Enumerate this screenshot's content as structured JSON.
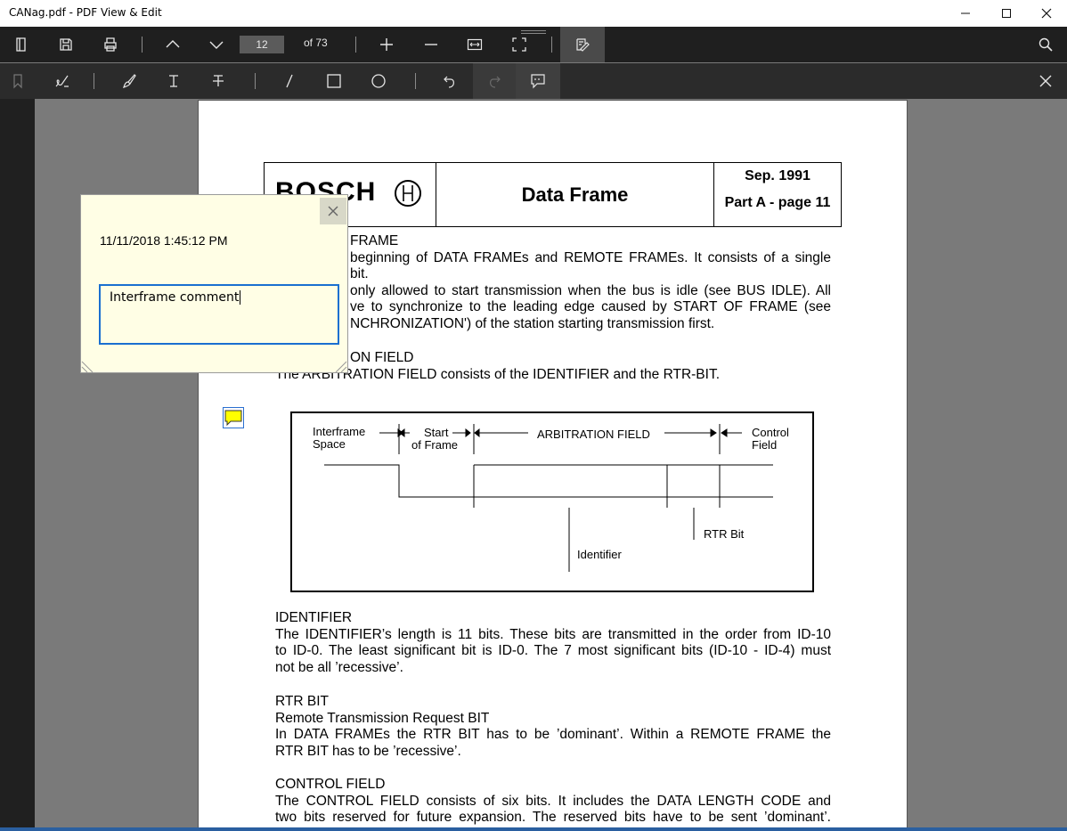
{
  "window": {
    "title": "CANag.pdf - PDF View & Edit"
  },
  "toolbar": {
    "page_number": "12",
    "page_total": "of 73"
  },
  "header": {
    "logo_text": "BOSCH",
    "title": "Data Frame",
    "date": "Sep. 1991",
    "part": "Part A - page 11"
  },
  "body": {
    "sof_heading": "FRAME",
    "sof_lines": [
      "beginning of DATA FRAMEs and REMOTE FRAMEs. It consists of a single",
      "bit.",
      "only allowed to start transmission when the bus is idle (see BUS IDLE). All",
      "ve to synchronize to the leading edge caused by START OF FRAME (see",
      "NCHRONIZATION') of the station starting transmission first."
    ],
    "arb_heading": "ON FIELD",
    "arb_line": "The ARBITRATION FIELD consists of the IDENTIFIER and the RTR-BIT.",
    "identifier_heading": "IDENTIFIER",
    "identifier_lines": [
      "The IDENTIFIER’s length is 11 bits. These bits are transmitted in the order from ID-10",
      "to ID-0. The least significant bit is ID-0. The 7 most significant bits (ID-10 - ID-4) must",
      "not be all ’recessive’."
    ],
    "rtr_heading": "RTR BIT",
    "rtr_lines": [
      "Remote Transmission Request BIT",
      "In DATA FRAMEs the RTR BIT has to be ’dominant’. Within a REMOTE FRAME the",
      "RTR BIT has to be ’recessive’."
    ],
    "control_heading": "CONTROL FIELD",
    "control_lines": [
      "The CONTROL FIELD consists of six bits. It includes the DATA LENGTH CODE and",
      "two bits reserved for future expansion. The reserved bits have to be sent ’dominant’."
    ]
  },
  "diagram": {
    "interframe": [
      "Interframe",
      "Space"
    ],
    "start": [
      "Start",
      "of Frame"
    ],
    "arbitration": "ARBITRATION FIELD",
    "control": [
      "Control",
      "Field"
    ],
    "rtr": "RTR Bit",
    "identifier": "Identifier"
  },
  "comment": {
    "timestamp": "11/11/2018 1:45:12 PM",
    "text": "Interframe comment"
  }
}
